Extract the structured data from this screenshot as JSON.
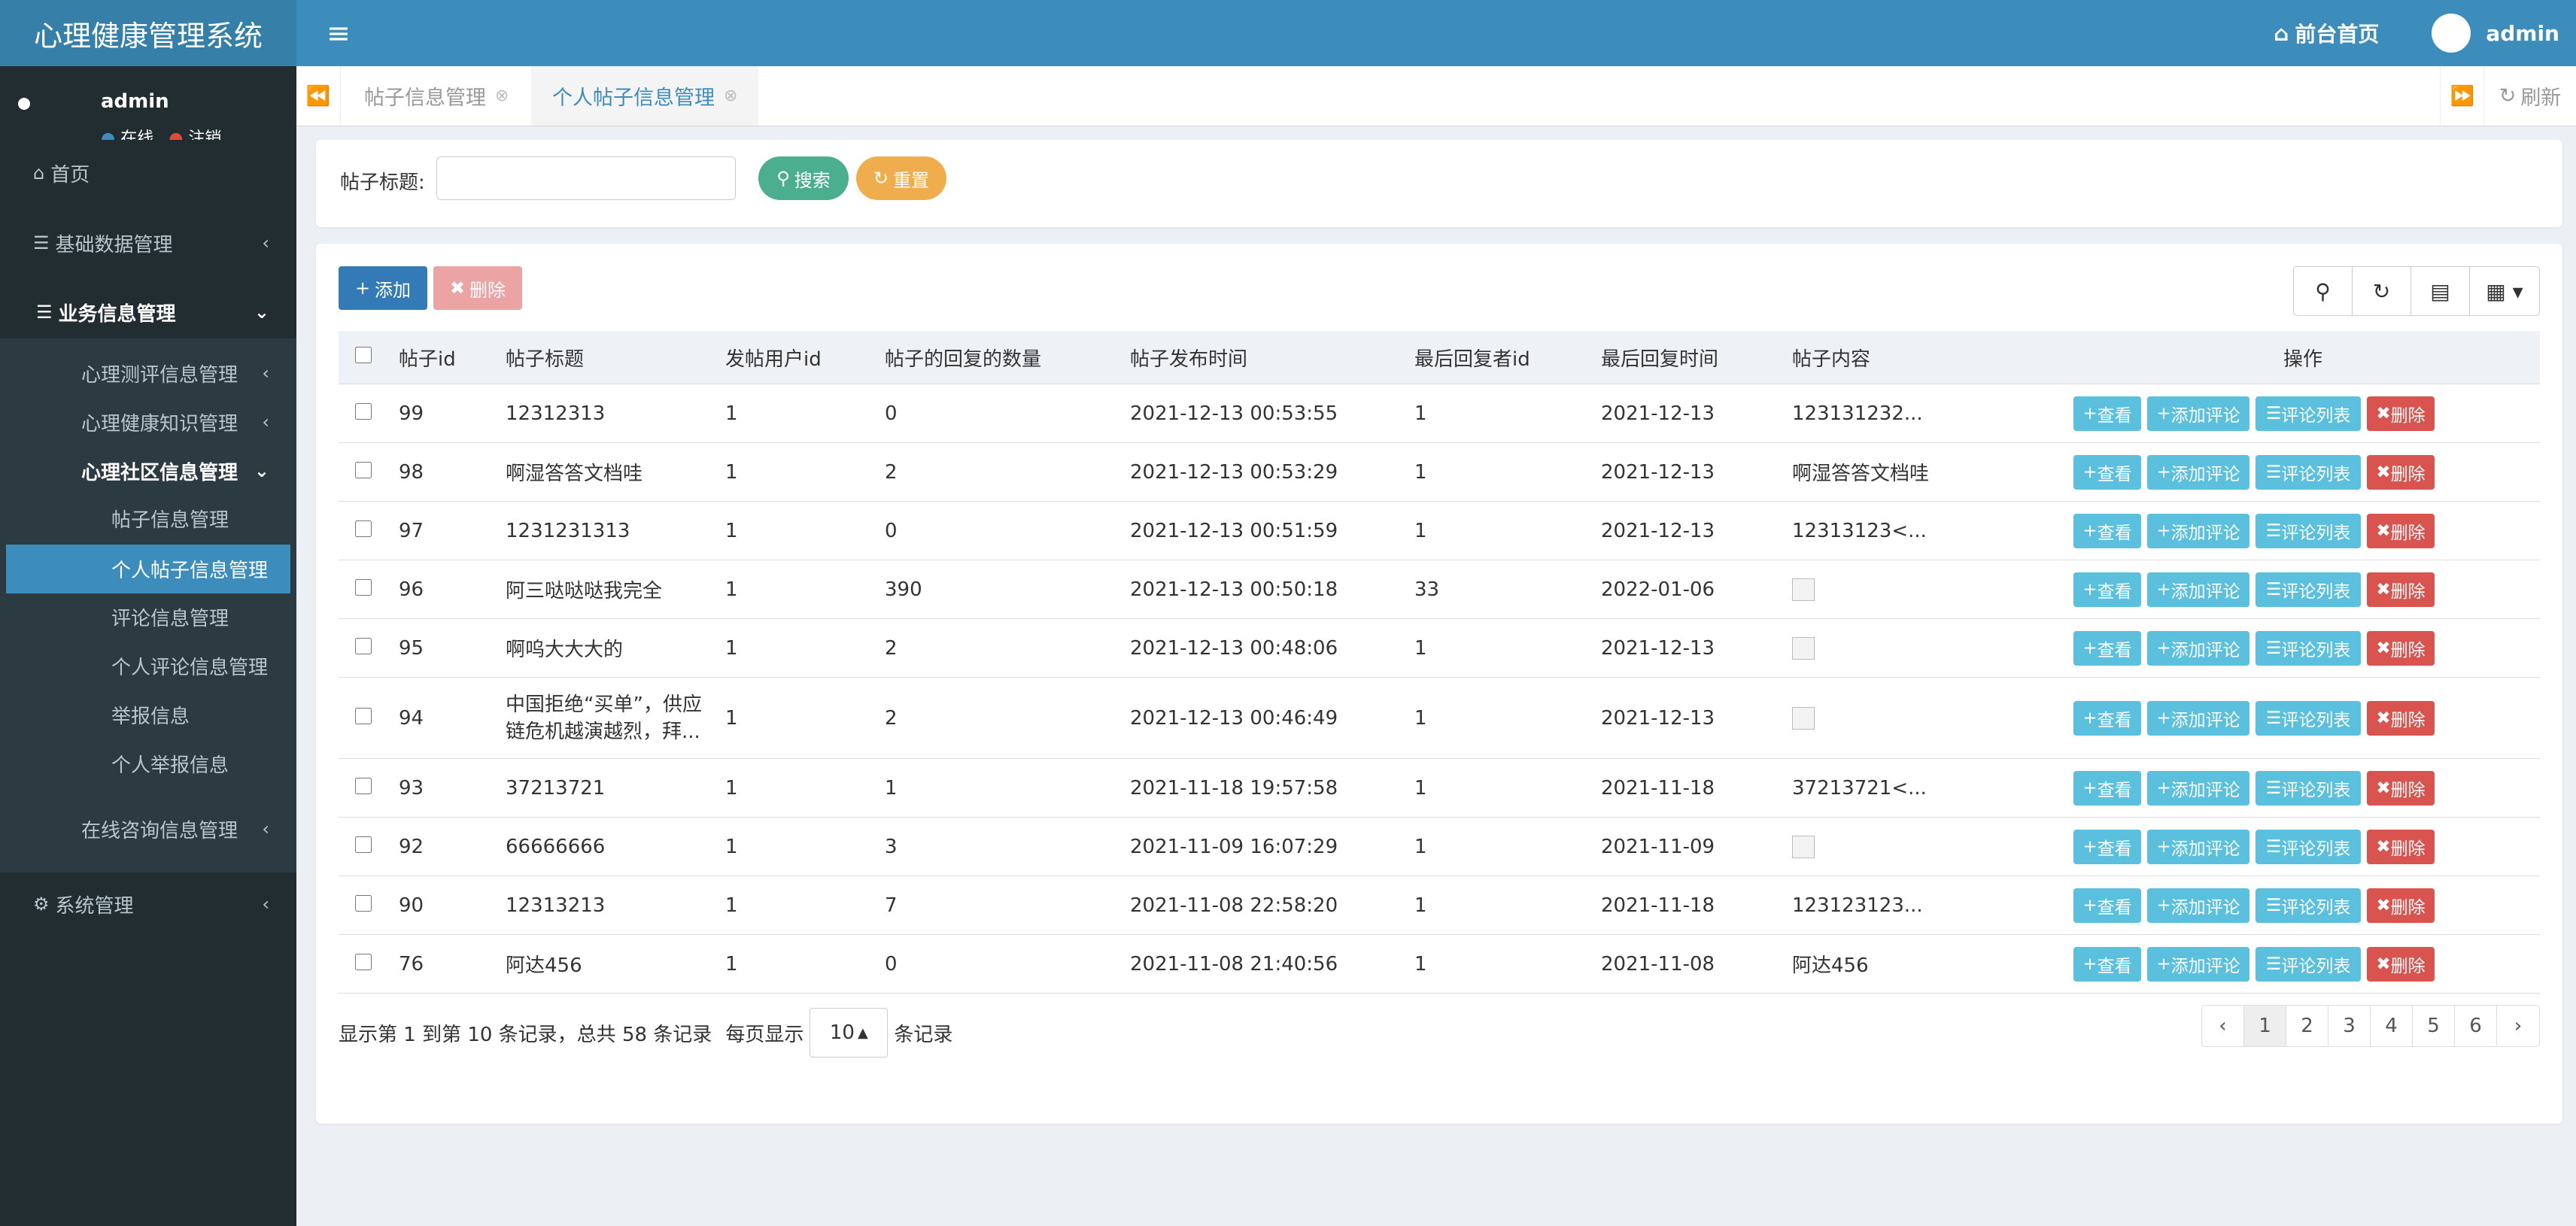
{
  "app": {
    "title": "心理健康管理系统"
  },
  "header": {
    "home_label": "前台首页",
    "user_name": "admin"
  },
  "sidebar": {
    "user": {
      "name": "admin",
      "status_online": "在线",
      "status_logout": "注销"
    },
    "home": "首页",
    "basic_data": "基础数据管理",
    "business": "业务信息管理",
    "eval": "心理测评信息管理",
    "knowledge": "心理健康知识管理",
    "community": "心理社区信息管理",
    "sub_items": [
      "帖子信息管理",
      "个人帖子信息管理",
      "评论信息管理",
      "个人评论信息管理",
      "举报信息",
      "个人举报信息"
    ],
    "consult": "在线咨询信息管理",
    "system": "系统管理"
  },
  "tabs": {
    "items": [
      "帖子信息管理",
      "个人帖子信息管理"
    ],
    "refresh": "刷新"
  },
  "search": {
    "label": "帖子标题:",
    "input_value": "",
    "search_btn": "搜索",
    "reset_btn": "重置"
  },
  "toolbar": {
    "add": "添加",
    "delete": "删除"
  },
  "table": {
    "headers": [
      "帖子id",
      "帖子标题",
      "发帖用户id",
      "帖子的回复的数量",
      "帖子发布时间",
      "最后回复者id",
      "最后回复时间",
      "帖子内容",
      "操作"
    ],
    "rows": [
      {
        "id": "99",
        "title": "12312313",
        "user": "1",
        "replies": "0",
        "time": "2021-12-13 00:53:55",
        "last_user": "1",
        "last_time": "2021-12-13",
        "content": "123131232..."
      },
      {
        "id": "98",
        "title": "啊湿答答文档哇",
        "user": "1",
        "replies": "2",
        "time": "2021-12-13 00:53:29",
        "last_user": "1",
        "last_time": "2021-12-13",
        "content": "啊湿答答文档哇"
      },
      {
        "id": "97",
        "title": "1231231313",
        "user": "1",
        "replies": "0",
        "time": "2021-12-13 00:51:59",
        "last_user": "1",
        "last_time": "2021-12-13",
        "content": "12313123<..."
      },
      {
        "id": "96",
        "title": "阿三哒哒哒我完全",
        "user": "1",
        "replies": "390",
        "time": "2021-12-13 00:50:18",
        "last_user": "33",
        "last_time": "2022-01-06",
        "content": ""
      },
      {
        "id": "95",
        "title": "啊呜大大大的",
        "user": "1",
        "replies": "2",
        "time": "2021-12-13 00:48:06",
        "last_user": "1",
        "last_time": "2021-12-13",
        "content": ""
      },
      {
        "id": "94",
        "title": "中国拒绝“买单”，供应链危机越演越烈，拜...",
        "user": "1",
        "replies": "2",
        "time": "2021-12-13 00:46:49",
        "last_user": "1",
        "last_time": "2021-12-13",
        "content": ""
      },
      {
        "id": "93",
        "title": "37213721",
        "user": "1",
        "replies": "1",
        "time": "2021-11-18 19:57:58",
        "last_user": "1",
        "last_time": "2021-11-18",
        "content": "37213721<..."
      },
      {
        "id": "92",
        "title": "66666666",
        "user": "1",
        "replies": "3",
        "time": "2021-11-09 16:07:29",
        "last_user": "1",
        "last_time": "2021-11-09",
        "content": ""
      },
      {
        "id": "90",
        "title": "12313213",
        "user": "1",
        "replies": "7",
        "time": "2021-11-08 22:58:20",
        "last_user": "1",
        "last_time": "2021-11-18",
        "content": "123123123..."
      },
      {
        "id": "76",
        "title": "阿达456",
        "user": "1",
        "replies": "0",
        "time": "2021-11-08 21:40:56",
        "last_user": "1",
        "last_time": "2021-11-08",
        "content": "阿达456"
      }
    ],
    "ops": {
      "view": "查看",
      "add_comment": "添加评论",
      "comment_list": "评论列表",
      "delete": "删除"
    }
  },
  "pager": {
    "info": "显示第 1 到第 10 条记录，总共 58 条记录",
    "per_page_prefix": "每页显示",
    "per_page_value": "10",
    "per_page_suffix": "条记录",
    "prev": "‹",
    "pages": [
      "1",
      "2",
      "3",
      "4",
      "5",
      "6"
    ],
    "next": "›"
  },
  "colors": {
    "header": "#3c8dbc",
    "sidebar": "#222d32",
    "green": "#4bae8e",
    "danger": "#d9534f",
    "info": "#5bc0de"
  }
}
